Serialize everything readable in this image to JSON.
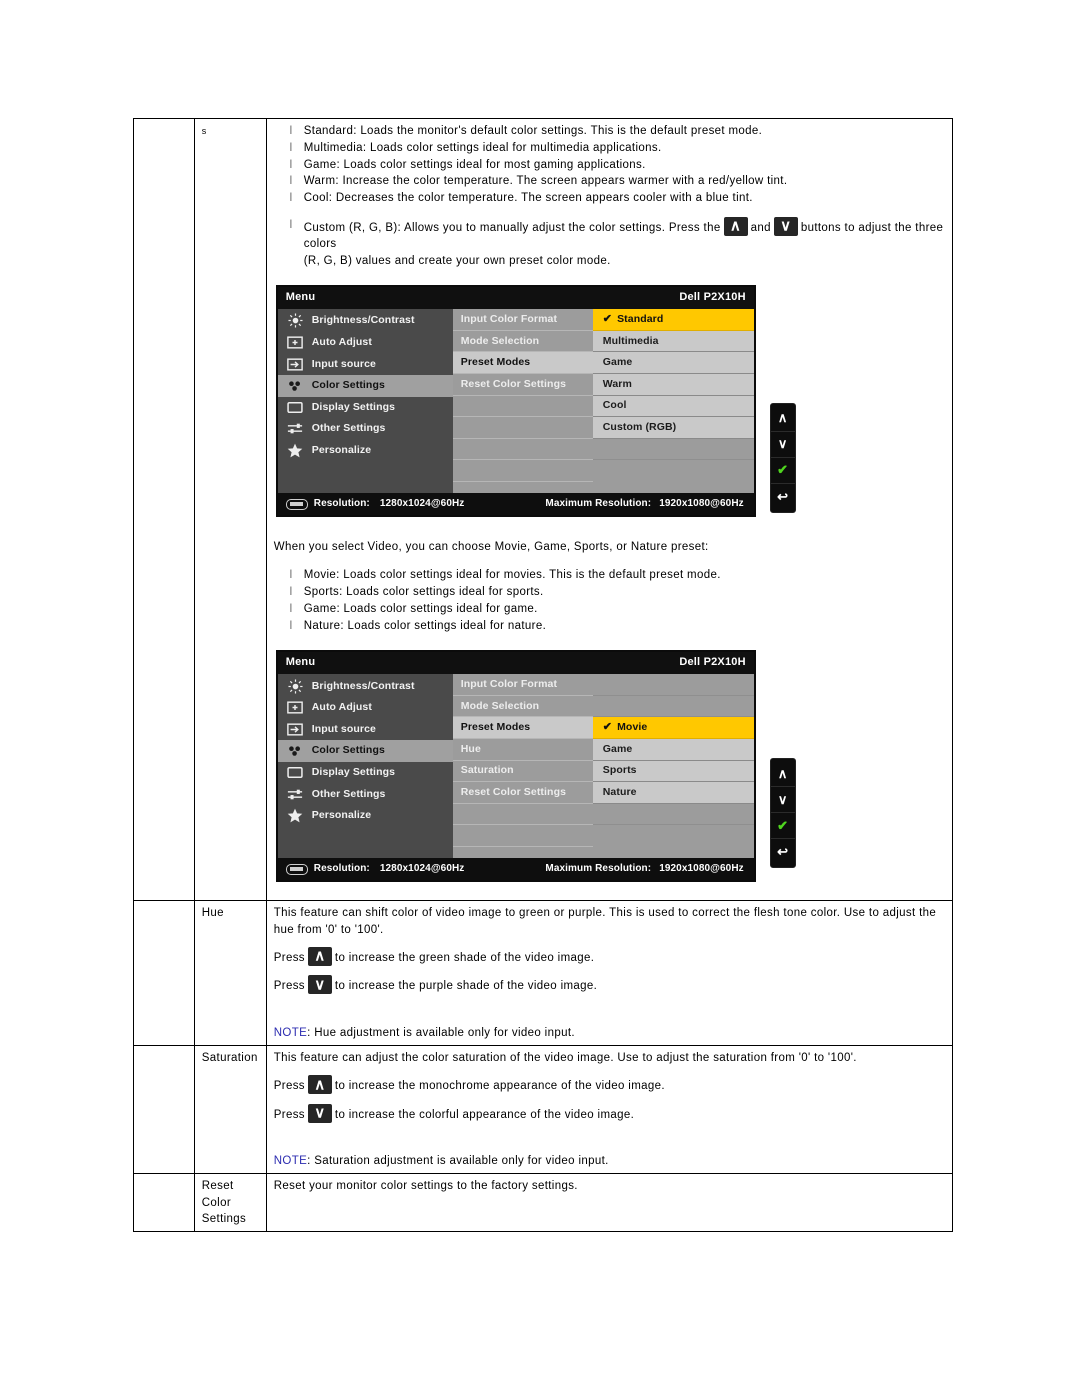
{
  "table": {
    "col_a_marker": "s",
    "rows": [
      {
        "label": "",
        "preset_intro_bullets": [
          "Standard: Loads the monitor's default color settings. This is the default preset mode.",
          "Multimedia: Loads color settings ideal for multimedia applications.",
          "Game: Loads color settings ideal for most gaming applications.",
          "Warm: Increase the color temperature. The screen appears warmer with a red/yellow tint.",
          "Cool: Decreases the color temperature. The screen appears cooler with a blue tint."
        ],
        "custom_bullet_part1": "Custom (R, G, B): Allows you to manually adjust the color settings. Press the",
        "custom_bullet_and": "and",
        "custom_bullet_part2": "buttons to adjust the three colors",
        "custom_bullet_line2": "(R, G, B) values and create your own preset color mode.",
        "video_intro": "When you select Video, you can choose Movie, Game, Sports, or Nature preset:",
        "video_bullets": [
          "Movie: Loads color settings ideal for movies. This is the default preset mode.",
          "Sports: Loads color settings ideal for sports.",
          "Game: Loads color settings ideal for game.",
          "Nature: Loads color settings ideal for nature."
        ]
      },
      {
        "label": "Hue",
        "body": "This feature can shift color of video image to green or purple. This is used to correct the flesh tone color. Use to adjust the hue from '0' to '100'.",
        "press_up_prefix": "Press",
        "press_up_suffix": "to increase the green shade of the video image.",
        "press_down_prefix": "Press",
        "press_down_suffix": "to increase the purple shade of the video image.",
        "note_tag": "NOTE",
        "note_text": ": Hue adjustment is available only for video input."
      },
      {
        "label": "Saturation",
        "body": "This feature can adjust the color saturation of the video image. Use to adjust the saturation from '0' to '100'.",
        "press_up_prefix": "Press",
        "press_up_suffix": "to increase the monochrome appearance of the video image.",
        "press_down_prefix": "Press",
        "press_down_suffix": "to increase the colorful appearance of the video image.",
        "note_tag": "NOTE",
        "note_text": ": Saturation adjustment is available only for video input."
      },
      {
        "label": "Reset Color Settings",
        "body": "Reset your monitor color settings to the factory settings."
      }
    ]
  },
  "osd1": {
    "title": "Menu",
    "model": "Dell P2X10H",
    "sidebar": [
      {
        "label": "Brightness/Contrast",
        "icon": "brightness-icon",
        "selected": false
      },
      {
        "label": "Auto Adjust",
        "icon": "auto-adjust-icon",
        "selected": false
      },
      {
        "label": "Input source",
        "icon": "input-source-icon",
        "selected": false
      },
      {
        "label": "Color Settings",
        "icon": "color-settings-icon",
        "selected": true
      },
      {
        "label": "Display Settings",
        "icon": "display-settings-icon",
        "selected": false
      },
      {
        "label": "Other Settings",
        "icon": "other-settings-icon",
        "selected": false
      },
      {
        "label": "Personalize",
        "icon": "personalize-star-icon",
        "selected": false
      }
    ],
    "middle": [
      {
        "label": "Input Color Format",
        "selected": false
      },
      {
        "label": "Mode Selection",
        "selected": false
      },
      {
        "label": "Preset Modes",
        "selected": true
      },
      {
        "label": "Reset Color Settings",
        "selected": false
      },
      {
        "label": "",
        "selected": false
      },
      {
        "label": "",
        "selected": false
      },
      {
        "label": "",
        "selected": false
      },
      {
        "label": "",
        "selected": false
      }
    ],
    "submenu": [
      {
        "label": "Standard",
        "checked": true
      },
      {
        "label": "Multimedia",
        "checked": false
      },
      {
        "label": "Game",
        "checked": false
      },
      {
        "label": "Warm",
        "checked": false
      },
      {
        "label": "Cool",
        "checked": false
      },
      {
        "label": "Custom (RGB)",
        "checked": false
      }
    ],
    "footer": {
      "resolution_label": "Resolution:",
      "resolution_value": "1280x1024@60Hz",
      "max_resolution_label": "Maximum Resolution:",
      "max_resolution_value": "1920x1080@60Hz"
    },
    "buttons": [
      {
        "name": "up-button",
        "glyph": "∧"
      },
      {
        "name": "down-button",
        "glyph": "∨"
      },
      {
        "name": "ok-button",
        "glyph": "✔"
      },
      {
        "name": "back-button",
        "glyph": "↩"
      }
    ]
  },
  "osd2": {
    "title": "Menu",
    "model": "Dell P2X10H",
    "sidebar": [
      {
        "label": "Brightness/Contrast",
        "icon": "brightness-icon",
        "selected": false
      },
      {
        "label": "Auto Adjust",
        "icon": "auto-adjust-icon",
        "selected": false
      },
      {
        "label": "Input source",
        "icon": "input-source-icon",
        "selected": false
      },
      {
        "label": "Color Settings",
        "icon": "color-settings-icon",
        "selected": true
      },
      {
        "label": "Display Settings",
        "icon": "display-settings-icon",
        "selected": false
      },
      {
        "label": "Other Settings",
        "icon": "other-settings-icon",
        "selected": false
      },
      {
        "label": "Personalize",
        "icon": "personalize-star-icon",
        "selected": false
      }
    ],
    "middle": [
      {
        "label": "Input Color Format",
        "selected": false
      },
      {
        "label": "Mode Selection",
        "selected": false
      },
      {
        "label": "Preset Modes",
        "selected": true
      },
      {
        "label": "Hue",
        "selected": false
      },
      {
        "label": "Saturation",
        "selected": false
      },
      {
        "label": "Reset Color Settings",
        "selected": false
      },
      {
        "label": "",
        "selected": false
      },
      {
        "label": "",
        "selected": false
      }
    ],
    "submenu": [
      {
        "label": "Movie",
        "checked": true
      },
      {
        "label": "Game",
        "checked": false
      },
      {
        "label": "Sports",
        "checked": false
      },
      {
        "label": "Nature",
        "checked": false
      }
    ],
    "footer": {
      "resolution_label": "Resolution:",
      "resolution_value": "1280x1024@60Hz",
      "max_resolution_label": "Maximum Resolution:",
      "max_resolution_value": "1920x1080@60Hz"
    },
    "buttons": [
      {
        "name": "up-button",
        "glyph": "∧"
      },
      {
        "name": "down-button",
        "glyph": "∨"
      },
      {
        "name": "ok-button",
        "glyph": "✔"
      },
      {
        "name": "back-button",
        "glyph": "↩"
      }
    ]
  },
  "colors": {
    "highlight": "#ffc800",
    "osd_background": "#141414",
    "sidebar": "#4a4a4a",
    "panel": "#9c9c9c",
    "note": "#2c2cb0",
    "ok_green": "#4fd41f"
  }
}
